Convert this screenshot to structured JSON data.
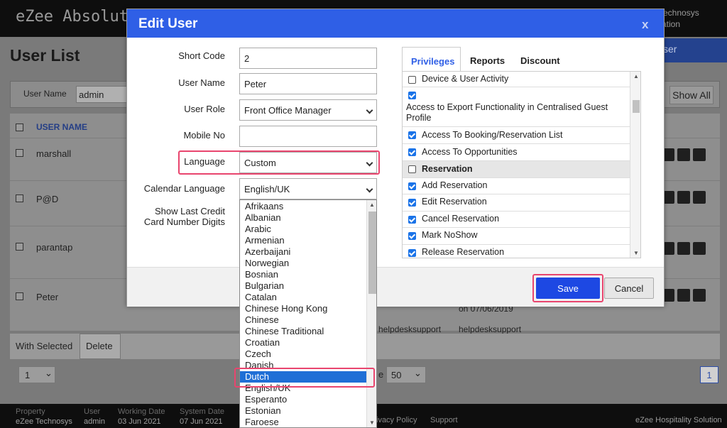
{
  "app": {
    "title": "eZee Absolute",
    "org_line1": "Technosys",
    "org_line2": "ration"
  },
  "background": {
    "page_title": "User List",
    "add_user_label": "ser",
    "filter_label": "User Name",
    "filter_value": "admin",
    "show_all_label": "Show All",
    "column_user_name": "USER NAME",
    "rows": [
      {
        "name": "marshall"
      },
      {
        "name": "P@D"
      },
      {
        "name": "parantap"
      },
      {
        "name": "Peter"
      }
    ],
    "peter_date_fragment": "on 07/06/2019",
    "helpdesk_left": "helpdesksupport",
    "helpdesk_right": "helpdesksupport",
    "with_selected_label": "With Selected",
    "delete_label": "Delete",
    "page_select": "1",
    "per_page_prefix": "e",
    "per_page_value": "50",
    "page_number": "1"
  },
  "status_bar": {
    "property_label": "Property",
    "property_value": "eZee Technosys",
    "user_label": "User",
    "user_value": "admin",
    "working_date_label": "Working Date",
    "working_date_value": "03 Jun 2021",
    "system_date_label": "System Date",
    "system_date_value": "07 Jun 2021",
    "privacy_label": "ivacy Policy",
    "support_label": "Support",
    "brand": "eZee Hospitality Solution"
  },
  "modal": {
    "title": "Edit User",
    "close_label": "x",
    "fields": {
      "short_code_label": "Short Code",
      "short_code_value": "2",
      "user_name_label": "User Name",
      "user_name_value": "Peter",
      "user_role_label": "User Role",
      "user_role_value": "Front Office Manager",
      "mobile_label": "Mobile No",
      "mobile_value": "",
      "language_label": "Language",
      "language_value": "Custom",
      "calendar_label": "Calendar Language",
      "calendar_value": "English/UK",
      "show_last_line1": "Show Last Credit",
      "show_last_line2": "Card Number Digits"
    },
    "tabs": [
      "Privileges",
      "Reports",
      "Discount"
    ],
    "privileges": [
      {
        "label": "Device & User Activity",
        "checked": false
      },
      {
        "label": "Access to Export Functionality in Centralised Guest Profile",
        "checked": true
      },
      {
        "label": "Access To Booking/Reservation List",
        "checked": true
      },
      {
        "label": "Access To Opportunities",
        "checked": true
      },
      {
        "label": "Reservation",
        "checked": false,
        "section": true
      },
      {
        "label": "Add Reservation",
        "checked": true
      },
      {
        "label": "Edit Reservation",
        "checked": true
      },
      {
        "label": "Cancel Reservation",
        "checked": true
      },
      {
        "label": "Mark NoShow",
        "checked": true
      },
      {
        "label": "Release Reservation",
        "checked": true
      }
    ],
    "save_label": "Save",
    "cancel_label": "Cancel"
  },
  "language_dropdown": {
    "options": [
      "Afrikaans",
      "Albanian",
      "Arabic",
      "Armenian",
      "Azerbaijani",
      "Norwegian",
      "Bosnian",
      "Bulgarian",
      "Catalan",
      "Chinese Hong Kong",
      "Chinese",
      "Chinese Traditional",
      "Croatian",
      "Czech",
      "Danish",
      "Dutch",
      "English/UK",
      "Esperanto",
      "Estonian",
      "Faroese"
    ],
    "selected": "Dutch"
  },
  "colors": {
    "header_blue": "#2f5fe6",
    "save_blue": "#1d48e3",
    "highlight": "#e9456e",
    "check_blue": "#1a73e8"
  }
}
